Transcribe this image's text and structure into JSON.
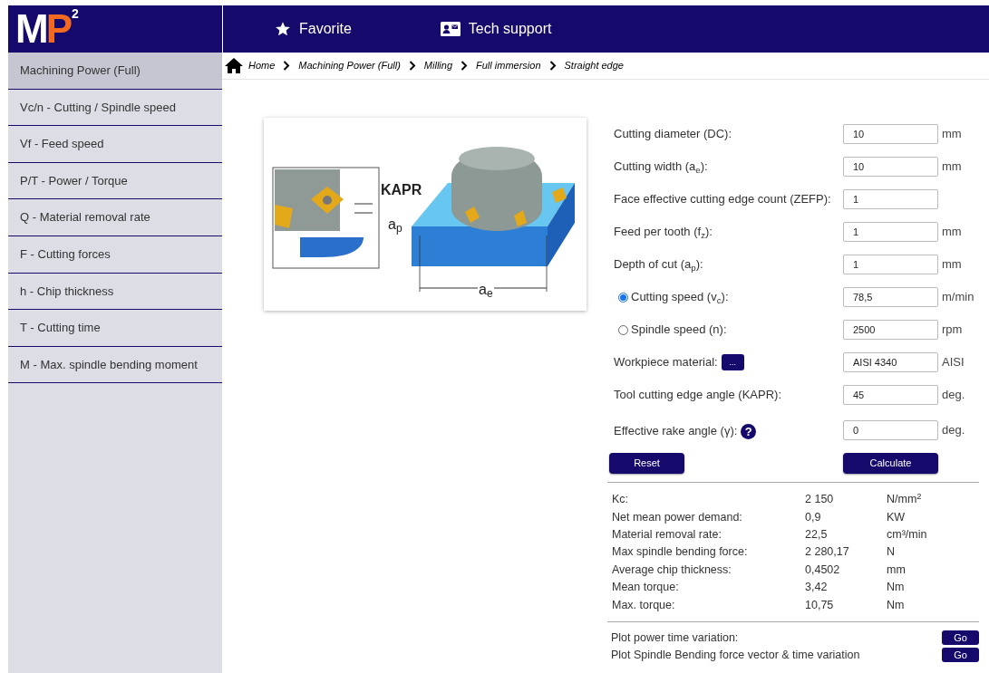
{
  "logo": {
    "letters": [
      "M",
      "P"
    ],
    "sup": "2"
  },
  "nav": [
    {
      "label": "Favorite"
    },
    {
      "label": "Tech support"
    }
  ],
  "sidebar": {
    "items": [
      {
        "label": "Machining Power (Full)",
        "selected": true
      },
      {
        "label": "Vc/n -  Cutting / Spindle speed",
        "selected": false
      },
      {
        "label": "Vf -  Feed speed",
        "selected": false
      },
      {
        "label": "P/T -  Power / Torque",
        "selected": false
      },
      {
        "label": "Q -  Material removal rate",
        "selected": false
      },
      {
        "label": "F -  Cutting forces",
        "selected": false
      },
      {
        "label": "h -  Chip thickness",
        "selected": false
      },
      {
        "label": "T -  Cutting time",
        "selected": false
      },
      {
        "label": "M -  Max. spindle bending moment",
        "selected": false
      }
    ]
  },
  "breadcrumb": [
    "Home",
    "Machining Power (Full)",
    "Milling",
    "Full immersion",
    "Straight edge"
  ],
  "diagram": {
    "labels": [
      "KAPR",
      "a$_{p}$",
      "a$_{e}$"
    ]
  },
  "form": {
    "fields": [
      {
        "kind": "text",
        "label": "Cutting diameter (DC):",
        "value": "10",
        "unit": "mm"
      },
      {
        "kind": "text",
        "label": "Cutting width (a$_{e}$):",
        "value": "10",
        "unit": "mm"
      },
      {
        "kind": "text",
        "label": "Face effective cutting edge count (ZEFP):",
        "value": "1"
      },
      {
        "kind": "text",
        "label": "Feed per tooth (f$_{z}$):",
        "value": "1",
        "unit": "mm"
      },
      {
        "kind": "text",
        "label": "Depth of cut (a$_{p}$):",
        "value": "1",
        "unit": "mm"
      },
      {
        "kind": "radio",
        "label": "Cutting speed (v$_{c}$):",
        "selected": true,
        "value": "78,5",
        "unit": "m/min"
      },
      {
        "kind": "radio",
        "label": "Spindle speed (n):",
        "selected": false,
        "value": "2500",
        "unit": "rpm"
      },
      {
        "kind": "picker",
        "label": "Workpiece material:",
        "button": "...",
        "value": "AISI 4340",
        "unit": "AISI"
      },
      {
        "kind": "text",
        "label": "Tool cutting edge angle (KAPR):",
        "value": "45",
        "unit": "deg."
      },
      {
        "kind": "help",
        "label": "Effective rake angle (γ):",
        "help": "?",
        "value": "0",
        "unit": "deg."
      }
    ],
    "buttons": [
      "Reset",
      "Calculate"
    ]
  },
  "results": [
    {
      "label": "Kc:",
      "value": "2 150",
      "unit": "N/mm$^{2}$"
    },
    {
      "label": "Net mean power demand:",
      "value": "0,9",
      "unit": "KW"
    },
    {
      "label": "Material removal rate:",
      "value": "22,5",
      "unit": "cm³/min"
    },
    {
      "label": "Max spindle bending force:",
      "value": "2 280,17",
      "unit": "N"
    },
    {
      "label": "Average chip thickness:",
      "value": "0,4502",
      "unit": "mm"
    },
    {
      "label": "Mean torque:",
      "value": "3,42",
      "unit": "Nm"
    },
    {
      "label": "Max. torque:",
      "value": "10,75",
      "unit": "Nm"
    }
  ],
  "plots": [
    {
      "label": "Plot power time variation:",
      "button": "Go"
    },
    {
      "label": "Plot Spindle Bending force vector & time variation",
      "button": "Go"
    }
  ]
}
